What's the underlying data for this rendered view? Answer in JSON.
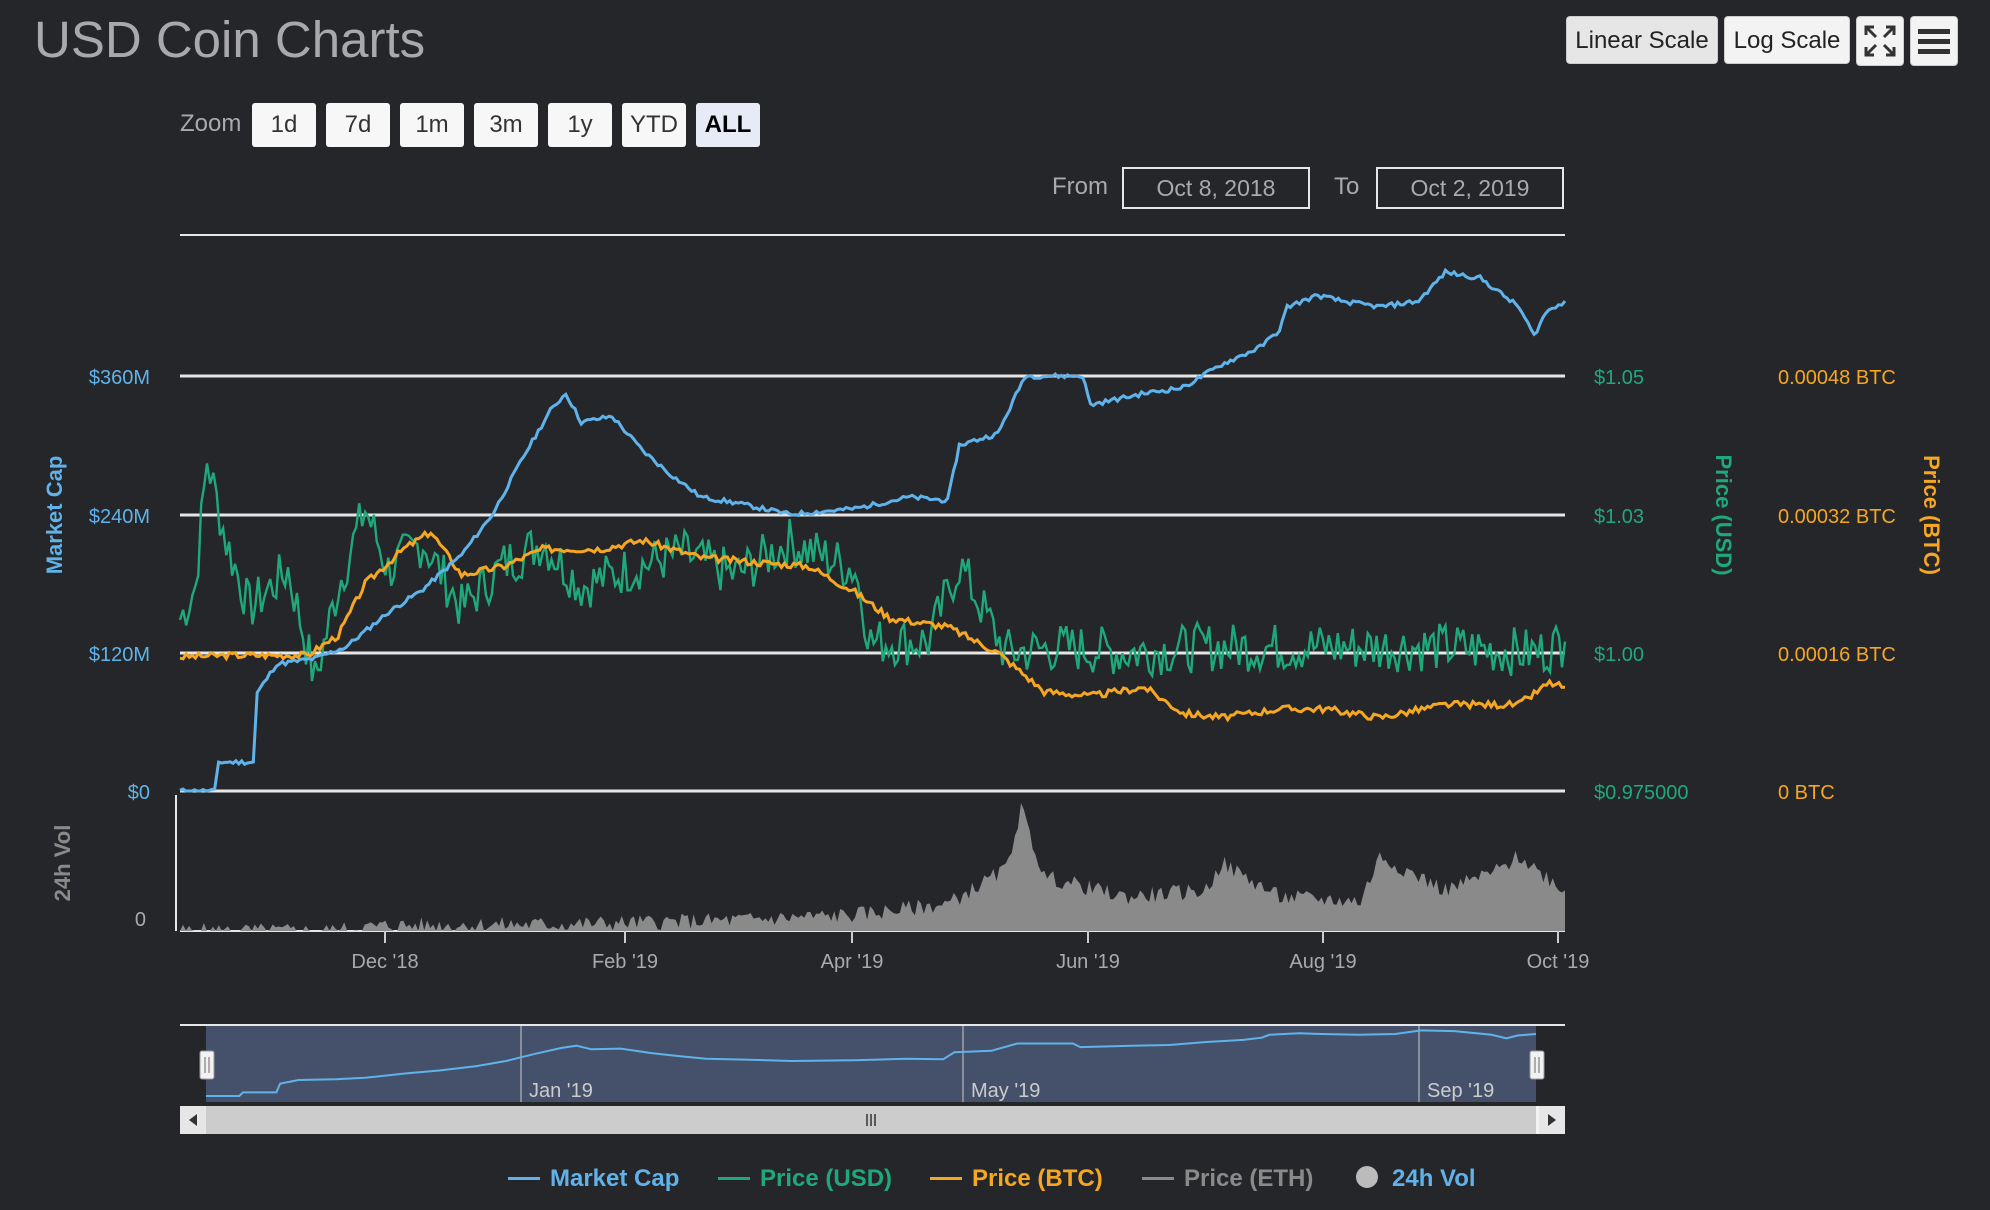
{
  "header": {
    "title": "USD Coin Charts"
  },
  "toolbar": {
    "linear_label": "Linear Scale",
    "log_label": "Log Scale",
    "fullscreen_icon": "fullscreen-icon",
    "menu_icon": "hamburger-menu-icon"
  },
  "zoom": {
    "label": "Zoom",
    "buttons": [
      "1d",
      "7d",
      "1m",
      "3m",
      "1y",
      "YTD",
      "ALL"
    ],
    "selected": "ALL"
  },
  "range": {
    "from_label": "From",
    "from_value": "Oct 8, 2018",
    "to_label": "To",
    "to_value": "Oct 2, 2019"
  },
  "colors": {
    "market_cap": "#5fb3ea",
    "price_usd": "#1fa97a",
    "price_btc": "#f5a623",
    "price_eth": "#8a8a8a",
    "volume": "#8a8a8a"
  },
  "chart_data": {
    "type": "line",
    "x_range": [
      "2018-10-08",
      "2019-10-02"
    ],
    "x_ticks": [
      "Dec '18",
      "Feb '19",
      "Apr '19",
      "Jun '19",
      "Aug '19",
      "Oct '19"
    ],
    "axes": {
      "market_cap": {
        "title": "Market Cap",
        "ticks": [
          "$0",
          "$120M",
          "$240M",
          "$360M"
        ],
        "range": [
          0,
          480000000
        ]
      },
      "price_usd": {
        "title": "Price (USD)",
        "ticks": [
          "$0.975000",
          "$1.00",
          "$1.03",
          "$1.05"
        ],
        "range": [
          0.975,
          1.075
        ]
      },
      "price_btc": {
        "title": "Price (BTC)",
        "ticks": [
          "0 BTC",
          "0.00016 BTC",
          "0.00032 BTC",
          "0.00048 BTC"
        ],
        "range": [
          0,
          0.00064
        ]
      },
      "volume": {
        "title": "24h Vol",
        "ticks": [
          "0"
        ]
      }
    },
    "series": [
      {
        "name": "Market Cap",
        "key": "market_cap",
        "points": [
          [
            "2018-10-08",
            0
          ],
          [
            "2018-10-17",
            0
          ],
          [
            "2018-10-18",
            25000000
          ],
          [
            "2018-10-27",
            25000000
          ],
          [
            "2018-10-28",
            85000000
          ],
          [
            "2018-11-02",
            110000000
          ],
          [
            "2018-11-12",
            115000000
          ],
          [
            "2018-11-20",
            125000000
          ],
          [
            "2018-12-01",
            155000000
          ],
          [
            "2018-12-10",
            175000000
          ],
          [
            "2018-12-20",
            205000000
          ],
          [
            "2018-12-28",
            240000000
          ],
          [
            "2019-01-05",
            290000000
          ],
          [
            "2019-01-12",
            330000000
          ],
          [
            "2019-01-16",
            345000000
          ],
          [
            "2019-01-20",
            320000000
          ],
          [
            "2019-01-28",
            325000000
          ],
          [
            "2019-02-05",
            295000000
          ],
          [
            "2019-02-12",
            275000000
          ],
          [
            "2019-02-20",
            255000000
          ],
          [
            "2019-03-01",
            250000000
          ],
          [
            "2019-03-15",
            240000000
          ],
          [
            "2019-04-01",
            245000000
          ],
          [
            "2019-04-15",
            255000000
          ],
          [
            "2019-04-25",
            252000000
          ],
          [
            "2019-04-28",
            300000000
          ],
          [
            "2019-05-08",
            310000000
          ],
          [
            "2019-05-15",
            360000000
          ],
          [
            "2019-05-30",
            360000000
          ],
          [
            "2019-06-01",
            335000000
          ],
          [
            "2019-06-15",
            345000000
          ],
          [
            "2019-06-25",
            350000000
          ],
          [
            "2019-07-05",
            370000000
          ],
          [
            "2019-07-15",
            385000000
          ],
          [
            "2019-07-20",
            400000000
          ],
          [
            "2019-07-22",
            420000000
          ],
          [
            "2019-07-30",
            430000000
          ],
          [
            "2019-08-05",
            425000000
          ],
          [
            "2019-08-15",
            420000000
          ],
          [
            "2019-08-25",
            425000000
          ],
          [
            "2019-09-01",
            450000000
          ],
          [
            "2019-09-10",
            445000000
          ],
          [
            "2019-09-20",
            420000000
          ],
          [
            "2019-09-24",
            395000000
          ],
          [
            "2019-09-27",
            415000000
          ],
          [
            "2019-10-02",
            425000000
          ]
        ]
      },
      {
        "name": "Price (USD)",
        "key": "price_usd",
        "points": [
          [
            "2018-10-08",
            1.006
          ],
          [
            "2018-10-12",
            1.012
          ],
          [
            "2018-10-15",
            1.035
          ],
          [
            "2018-10-20",
            1.02
          ],
          [
            "2018-10-26",
            1.008
          ],
          [
            "2018-11-05",
            1.015
          ],
          [
            "2018-11-12",
            0.995
          ],
          [
            "2018-11-18",
            1.012
          ],
          [
            "2018-11-25",
            1.026
          ],
          [
            "2018-12-01",
            1.015
          ],
          [
            "2018-12-10",
            1.02
          ],
          [
            "2018-12-20",
            1.008
          ],
          [
            "2018-12-31",
            1.016
          ],
          [
            "2019-01-10",
            1.02
          ],
          [
            "2019-01-20",
            1.012
          ],
          [
            "2019-02-01",
            1.015
          ],
          [
            "2019-02-15",
            1.018
          ],
          [
            "2019-03-01",
            1.014
          ],
          [
            "2019-03-15",
            1.02
          ],
          [
            "2019-04-01",
            1.015
          ],
          [
            "2019-04-05",
            1.002
          ],
          [
            "2019-04-20",
            1.002
          ],
          [
            "2019-04-28",
            1.016
          ],
          [
            "2019-05-10",
            1.0
          ],
          [
            "2019-05-25",
            1.001
          ],
          [
            "2019-06-10",
            1.0
          ],
          [
            "2019-07-01",
            1.001
          ],
          [
            "2019-08-01",
            1.001
          ],
          [
            "2019-09-01",
            1.001
          ],
          [
            "2019-09-25",
            1.0
          ],
          [
            "2019-10-02",
            1.002
          ]
        ]
      },
      {
        "name": "Price (BTC)",
        "key": "price_btc",
        "points": [
          [
            "2018-10-08",
            0.000155
          ],
          [
            "2018-10-20",
            0.000157
          ],
          [
            "2018-11-10",
            0.000157
          ],
          [
            "2018-11-18",
            0.00018
          ],
          [
            "2018-11-25",
            0.00024
          ],
          [
            "2018-12-05",
            0.00028
          ],
          [
            "2018-12-12",
            0.0003
          ],
          [
            "2018-12-20",
            0.00025
          ],
          [
            "2018-12-31",
            0.00026
          ],
          [
            "2019-01-10",
            0.00028
          ],
          [
            "2019-01-25",
            0.00028
          ],
          [
            "2019-02-05",
            0.00029
          ],
          [
            "2019-02-20",
            0.00027
          ],
          [
            "2019-03-05",
            0.000265
          ],
          [
            "2019-03-20",
            0.00026
          ],
          [
            "2019-04-01",
            0.00023
          ],
          [
            "2019-04-10",
            0.0002
          ],
          [
            "2019-04-25",
            0.00019
          ],
          [
            "2019-05-08",
            0.00016
          ],
          [
            "2019-05-20",
            0.000115
          ],
          [
            "2019-06-01",
            0.00011
          ],
          [
            "2019-06-15",
            0.00012
          ],
          [
            "2019-06-25",
            9e-05
          ],
          [
            "2019-07-05",
            8.5e-05
          ],
          [
            "2019-07-20",
            9.5e-05
          ],
          [
            "2019-08-01",
            9.5e-05
          ],
          [
            "2019-08-15",
            8.5e-05
          ],
          [
            "2019-09-01",
            0.0001
          ],
          [
            "2019-09-20",
            0.0001
          ],
          [
            "2019-09-28",
            0.000125
          ],
          [
            "2019-10-02",
            0.00012
          ]
        ]
      },
      {
        "name": "Price (ETH)",
        "key": "price_eth",
        "points": []
      },
      {
        "name": "24h Vol",
        "key": "volume",
        "type": "area",
        "points": [
          [
            "2018-10-08",
            0
          ],
          [
            "2018-11-15",
            0
          ],
          [
            "2018-12-01",
            0.04
          ],
          [
            "2019-01-15",
            0.05
          ],
          [
            "2019-03-01",
            0.08
          ],
          [
            "2019-04-01",
            0.12
          ],
          [
            "2019-04-25",
            0.2
          ],
          [
            "2019-05-10",
            0.45
          ],
          [
            "2019-05-14",
            0.9
          ],
          [
            "2019-05-20",
            0.4
          ],
          [
            "2019-06-10",
            0.25
          ],
          [
            "2019-07-01",
            0.3
          ],
          [
            "2019-07-05",
            0.5
          ],
          [
            "2019-07-20",
            0.25
          ],
          [
            "2019-08-10",
            0.22
          ],
          [
            "2019-08-15",
            0.55
          ],
          [
            "2019-09-01",
            0.3
          ],
          [
            "2019-09-15",
            0.45
          ],
          [
            "2019-09-20",
            0.55
          ],
          [
            "2019-10-02",
            0.3
          ]
        ]
      }
    ],
    "navigator": {
      "ticks": [
        "Jan '19",
        "May '19",
        "Sep '19"
      ]
    },
    "legend": {
      "position": "bottom",
      "items": [
        "Market Cap",
        "Price (USD)",
        "Price (BTC)",
        "Price (ETH)",
        "24h Vol"
      ]
    },
    "grid": true
  }
}
